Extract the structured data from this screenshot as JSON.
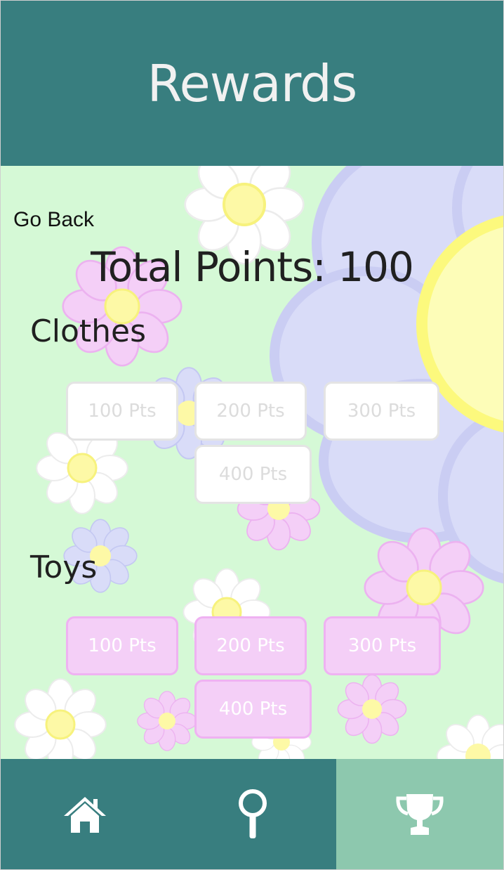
{
  "header": {
    "title": "Rewards"
  },
  "nav_back": {
    "label": "Go Back"
  },
  "points": {
    "label": "Total Points: 100"
  },
  "sections": [
    {
      "title": "Clothes",
      "buttons": [
        "100 Pts",
        "200 Pts",
        "300 Pts",
        "400 Pts"
      ]
    },
    {
      "title": "Toys",
      "buttons": [
        "100 Pts",
        "200 Pts",
        "300 Pts",
        "400 Pts"
      ]
    }
  ],
  "bottom_nav": {
    "items": [
      {
        "icon": "home-icon",
        "active": false
      },
      {
        "icon": "magnifier-icon",
        "active": false
      },
      {
        "icon": "trophy-icon",
        "active": true
      }
    ]
  },
  "colors": {
    "header": "#387e7f",
    "background": "#d5f9d6",
    "nav_active": "#8dc8ae",
    "toy_button": "#f4cff7",
    "clothes_button": "#ffffff"
  }
}
